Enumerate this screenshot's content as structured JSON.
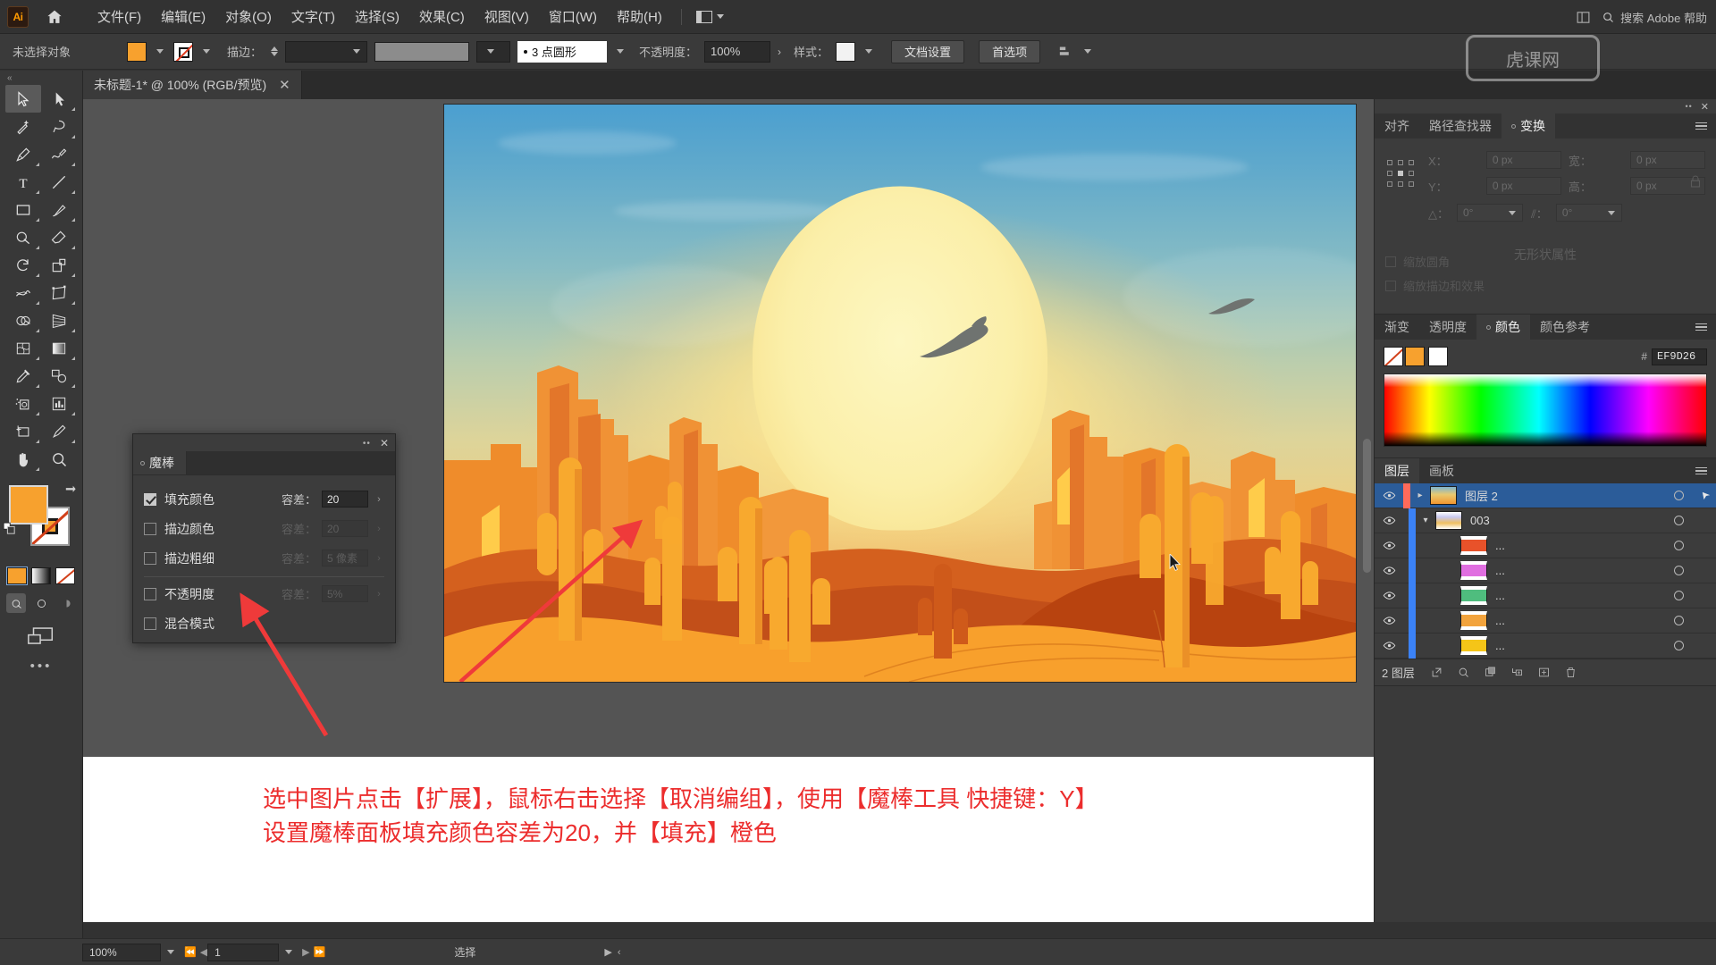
{
  "app": {
    "name": "Adobe Illustrator",
    "logo_text": "Ai",
    "accent": "#ff9a00"
  },
  "menubar": {
    "items": [
      {
        "label": "文件(F)"
      },
      {
        "label": "编辑(E)"
      },
      {
        "label": "对象(O)"
      },
      {
        "label": "文字(T)"
      },
      {
        "label": "选择(S)"
      },
      {
        "label": "效果(C)"
      },
      {
        "label": "视图(V)"
      },
      {
        "label": "窗口(W)"
      },
      {
        "label": "帮助(H)"
      }
    ],
    "search_placeholder": "搜索 Adobe 帮助"
  },
  "controlbar": {
    "selection_status": "未选择对象",
    "stroke_label": "描边：",
    "stroke_weight": "",
    "stroke_profile": "3 点圆形",
    "opacity_label": "不透明度：",
    "opacity_value": "100%",
    "style_label": "样式：",
    "document_setup": "文档设置",
    "preferences": "首选项",
    "fill_color": "#F7A12E",
    "stroke_color": "#FFFFFF"
  },
  "document_tab": {
    "title": "未标题-1* @ 100% (RGB/预览)",
    "close": "✕"
  },
  "toolbar": {
    "collapse": "«",
    "tools": [
      {
        "name": "selection-tool",
        "label": "选择工具",
        "active": true
      },
      {
        "name": "direct-selection-tool",
        "label": "直接选择工具",
        "active": false
      },
      {
        "name": "magic-wand-tool",
        "label": "魔棒工具",
        "active": false
      },
      {
        "name": "lasso-tool",
        "label": "套索工具",
        "active": false
      },
      {
        "name": "pen-tool",
        "label": "钢笔工具",
        "active": false
      },
      {
        "name": "curvature-tool",
        "label": "曲率工具",
        "active": false
      },
      {
        "name": "type-tool",
        "label": "文字工具",
        "active": false
      },
      {
        "name": "line-segment-tool",
        "label": "直线段工具",
        "active": false
      },
      {
        "name": "rectangle-tool",
        "label": "矩形工具",
        "active": false
      },
      {
        "name": "paintbrush-tool",
        "label": "画笔工具",
        "active": false
      },
      {
        "name": "shaper-tool",
        "label": "Shaper 工具",
        "active": false
      },
      {
        "name": "eraser-tool",
        "label": "橡皮擦工具",
        "active": false
      },
      {
        "name": "rotate-tool",
        "label": "旋转工具",
        "active": false
      },
      {
        "name": "scale-tool",
        "label": "比例缩放工具",
        "active": false
      },
      {
        "name": "width-tool",
        "label": "宽度工具",
        "active": false
      },
      {
        "name": "free-transform-tool",
        "label": "自由变换工具",
        "active": false
      },
      {
        "name": "shape-builder-tool",
        "label": "形状生成器工具",
        "active": false
      },
      {
        "name": "perspective-grid-tool",
        "label": "透视网格工具",
        "active": false
      },
      {
        "name": "mesh-tool",
        "label": "网格工具",
        "active": false
      },
      {
        "name": "gradient-tool",
        "label": "渐变工具",
        "active": false
      },
      {
        "name": "eyedropper-tool",
        "label": "吸管工具",
        "active": false
      },
      {
        "name": "blend-tool",
        "label": "混合工具",
        "active": false
      },
      {
        "name": "symbol-sprayer-tool",
        "label": "符号喷枪工具",
        "active": false
      },
      {
        "name": "column-graph-tool",
        "label": "柱形图工具",
        "active": false
      },
      {
        "name": "artboard-tool",
        "label": "画板工具",
        "active": false
      },
      {
        "name": "slice-tool",
        "label": "切片工具",
        "active": false
      },
      {
        "name": "hand-tool",
        "label": "抓手工具",
        "active": false
      },
      {
        "name": "zoom-tool",
        "label": "缩放工具",
        "active": false
      }
    ],
    "fill_color": "#F7A12E",
    "stroke_color": "#FFFFFF",
    "mode_swatches": [
      "颜色",
      "渐变",
      "无"
    ],
    "more_tools": "•••"
  },
  "magic_wand_panel": {
    "title": "魔棒",
    "close": "✕",
    "grip": "••",
    "rows": [
      {
        "label": "填充颜色",
        "checked": true,
        "tol_label": "容差：",
        "tol_value": "20",
        "enabled": true
      },
      {
        "label": "描边颜色",
        "checked": false,
        "tol_label": "容差：",
        "tol_value": "20",
        "enabled": false
      },
      {
        "label": "描边粗细",
        "checked": false,
        "tol_label": "容差：",
        "tol_value": "5 像素",
        "enabled": false
      },
      {
        "label": "不透明度",
        "checked": false,
        "tol_label": "容差：",
        "tol_value": "5%",
        "enabled": false
      },
      {
        "label": "混合模式",
        "checked": false,
        "tol_label": "",
        "tol_value": "",
        "enabled": false
      }
    ]
  },
  "transform_panel": {
    "tabs": [
      {
        "label": "对齐",
        "active": false
      },
      {
        "label": "路径查找器",
        "active": false
      },
      {
        "label": "变换",
        "active": true
      }
    ],
    "fields": {
      "x_label": "X：",
      "x_value": "0 px",
      "y_label": "Y：",
      "y_value": "0 px",
      "w_label": "宽：",
      "w_value": "0 px",
      "h_label": "高：",
      "h_value": "0 px",
      "angle_label": "△：",
      "angle_value": "0°",
      "shear_label": "⫽：",
      "shear_value": "0°"
    },
    "no_properties": "无形状属性",
    "checks": [
      {
        "label": "缩放圆角"
      },
      {
        "label": "缩放描边和效果"
      }
    ]
  },
  "color_panel": {
    "tabs": [
      {
        "label": "渐变",
        "active": false
      },
      {
        "label": "透明度",
        "active": false
      },
      {
        "label": "颜色",
        "active": true
      },
      {
        "label": "颜色参考",
        "active": false
      }
    ],
    "hash": "#",
    "hex_value": "EF9D26",
    "fill_color": "#EF9D26",
    "stroke_color": "#FFFFFF"
  },
  "layers_panel": {
    "tabs": [
      {
        "label": "图层",
        "active": true
      },
      {
        "label": "画板",
        "active": false
      }
    ],
    "rows": [
      {
        "name": "图层 2",
        "selected": true,
        "indent": 0,
        "color": "#ff6a5a",
        "disclosure": "▸",
        "thumb": "artwork"
      },
      {
        "name": "003",
        "selected": false,
        "indent": 1,
        "color": "#3b82f6",
        "disclosure": "▾",
        "thumb": "group"
      },
      {
        "name": "...",
        "selected": false,
        "indent": 2,
        "color": "#3b82f6",
        "disclosure": "",
        "thumb": "#e8522a"
      },
      {
        "name": "...",
        "selected": false,
        "indent": 2,
        "color": "#3b82f6",
        "disclosure": "",
        "thumb": "#e06ee0"
      },
      {
        "name": "...",
        "selected": false,
        "indent": 2,
        "color": "#3b82f6",
        "disclosure": "",
        "thumb": "#4fbd7e"
      },
      {
        "name": "...",
        "selected": false,
        "indent": 2,
        "color": "#3b82f6",
        "disclosure": "",
        "thumb": "#f2a33c"
      },
      {
        "name": "...",
        "selected": false,
        "indent": 2,
        "color": "#3b82f6",
        "disclosure": "",
        "thumb": "#f5c518"
      }
    ],
    "footer_count": "2 图层"
  },
  "annotation": {
    "line1": "选中图片点击【扩展】，鼠标右击选择【取消编组】，使用【魔棒工具 快捷键：Y】",
    "line2": "设置魔棒面板填充颜色容差为20，并【填充】橙色",
    "color": "#ec2d2d"
  },
  "statusbar": {
    "zoom": "100%",
    "page": "1",
    "status_text": "选择"
  },
  "artwork": {
    "title": "沙漠日落插画",
    "sun_color": "#FBEFA9",
    "sand_color": "#F7A12E",
    "dune_color": "#C8501A",
    "mesa_color": "#F08A2E",
    "sky_top": "#4B9FD0"
  },
  "watermark": {
    "text": "虎课网"
  }
}
